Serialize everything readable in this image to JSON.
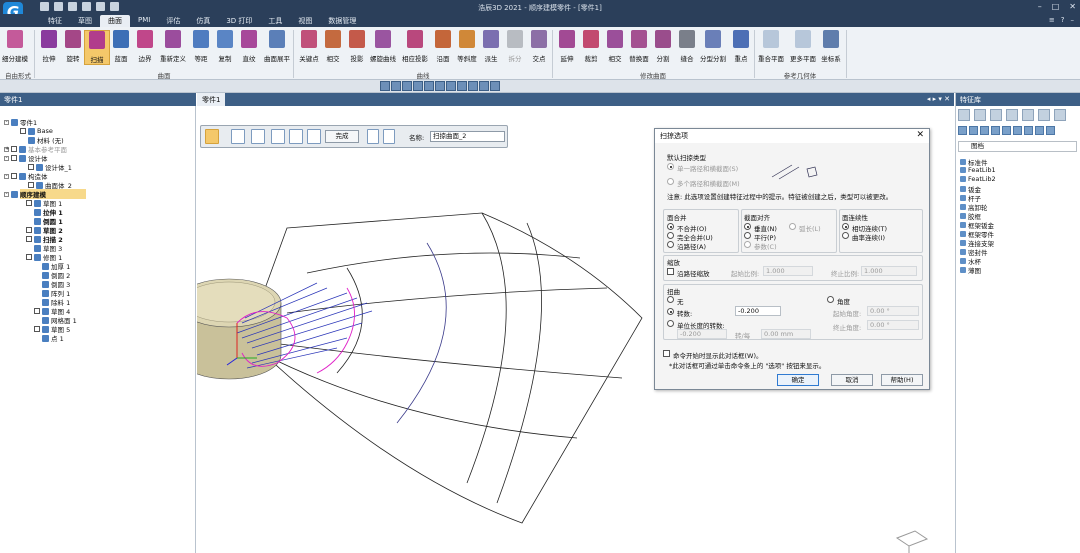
{
  "app": {
    "title": "浩辰3D 2021 - 顺序建模零件 - [零件1]",
    "logo": "G"
  },
  "tabs": [
    "特征",
    "草图",
    "曲面",
    "PMI",
    "评估",
    "仿真",
    "3D 打印",
    "工具",
    "视图",
    "数据管理"
  ],
  "active_tab": "曲面",
  "ribbon": {
    "buttons": [
      "细分建模",
      "拉伸",
      "旋转",
      "扫描",
      "蓝面",
      "边界",
      "重新定义",
      "等距",
      "复制",
      "直纹",
      "曲面展平",
      "关键点",
      "相交",
      "投影",
      "螺旋曲线",
      "相应投影",
      "沿面",
      "等斜度",
      "派生",
      "拆分",
      "交点",
      "延伸",
      "裁剪",
      "相交",
      "替换面",
      "分割",
      "缝合",
      "分型分割",
      "重点",
      "重合平面",
      "更多平面",
      "坐标系"
    ],
    "groups": [
      "自由形式",
      "曲面",
      "曲线",
      "修改曲面",
      "参考几何体"
    ]
  },
  "left_panel": {
    "tab": "零件1",
    "tree": [
      "零件1",
      "Base",
      "材料 (无)",
      "基本参考平面",
      "设计体",
      "设计体_1",
      "构造体",
      "曲面体_2",
      "顺序建模",
      "草图 1",
      "拉伸 1",
      "倒圆 1",
      "草图 2",
      "扫描 2",
      "草图 3",
      "修图 1",
      "加厚 1",
      "倒圆 2",
      "倒圆 3",
      "阵列 1",
      "除料 1",
      "草图 4",
      "网格面 1",
      "草图 5",
      "点 1"
    ]
  },
  "sketch_toolbar": {
    "done": "完成",
    "name_label": "名称:",
    "name_value": "扫掠曲面_2"
  },
  "dialog": {
    "title": "扫掠选项",
    "default_type_label": "默认扫掠类型",
    "opt_single": "单一路径和横截面(S)",
    "opt_multi": "多个路径和横截面(M)",
    "note": "注意: 此选项设置创建特征过程中的提示。特征被创建之后，类型可以被更改。",
    "merge_label": "面合并",
    "merge_opts": [
      "不合并(O)",
      "完全合并(U)",
      "沿路径(A)"
    ],
    "section_label": "截面对齐",
    "section_opts": [
      "垂直(N)",
      "平行(P)",
      "参数(C)",
      "弧长(L)"
    ],
    "continuity_label": "面连续性",
    "continuity_opts": [
      "相切连续(T)",
      "曲率连续(I)"
    ],
    "scale_label": "缩放",
    "scale_check": "沿路径缩放",
    "start_ratio": "起始比例:",
    "start_ratio_val": "1.000",
    "end_ratio": "终止比例:",
    "end_ratio_val": "1.000",
    "twist_label": "扭曲",
    "twist_none": "无",
    "twist_turns": "转数:",
    "twist_turns_val": "-0.200",
    "twist_perlen": "单位长度的转数:",
    "twist_perlen_val": "-0.200",
    "turns_per": "转/每",
    "per_len_val": "0.00 mm",
    "angle_label": "角度",
    "start_angle": "起始角度:",
    "start_angle_val": "0.00 °",
    "end_angle": "终止角度:",
    "end_angle_val": "0.00 °",
    "show_check": "命令开始时显示此对话框(W)。",
    "hint": "*此对话框可通过单击命令条上的 \"选项\" 按钮来显示。",
    "ok": "确定",
    "cancel": "取消",
    "help": "帮助(H)"
  },
  "right_panel": {
    "title": "特征库",
    "folder": "图档",
    "items": [
      "标准件",
      "FeatLib1",
      "FeatLib2",
      "钣金",
      "杆子",
      "高卸轮",
      "胶框",
      "框架钣金",
      "框架零件",
      "连接支架",
      "密封件",
      "水杯",
      "薄图"
    ]
  },
  "colors": {
    "titlebar": "#2b3f5a",
    "accent": "#3d5f86",
    "highlight": "#f7d98b"
  }
}
